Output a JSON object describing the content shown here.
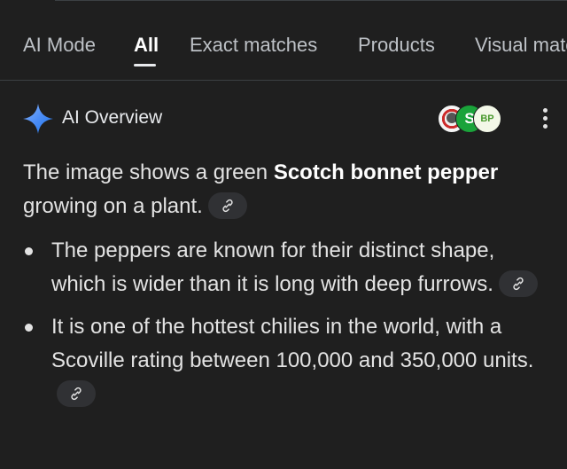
{
  "tabs": [
    {
      "label": "AI Mode",
      "active": false
    },
    {
      "label": "All",
      "active": true
    },
    {
      "label": "Exact matches",
      "active": false
    },
    {
      "label": "Products",
      "active": false
    },
    {
      "label": "Visual matches",
      "active": false
    }
  ],
  "overview": {
    "title": "AI Overview",
    "icon": "sparkle-icon",
    "sources": [
      {
        "icon": "source-favicon-1",
        "text": ""
      },
      {
        "icon": "source-favicon-2",
        "text": "S"
      },
      {
        "icon": "source-favicon-3",
        "text": "BP"
      }
    ],
    "menu_icon": "more-vert-icon"
  },
  "answer": {
    "intro_before": "The image shows a green ",
    "intro_bold": "Scotch bonnet pepper",
    "intro_after": " growing on a plant.",
    "bullets": [
      "The peppers are known for their distinct shape, which is wider than it is long with deep furrows.",
      "It is one of the hottest chilies in the world, with a Scoville rating between 100,000 and 350,000 units."
    ],
    "link_icon": "link-icon"
  },
  "colors": {
    "background": "#1f1f1f",
    "text": "#e3e3e3",
    "chip": "#303134",
    "accent_blue": "#4c8df6"
  }
}
